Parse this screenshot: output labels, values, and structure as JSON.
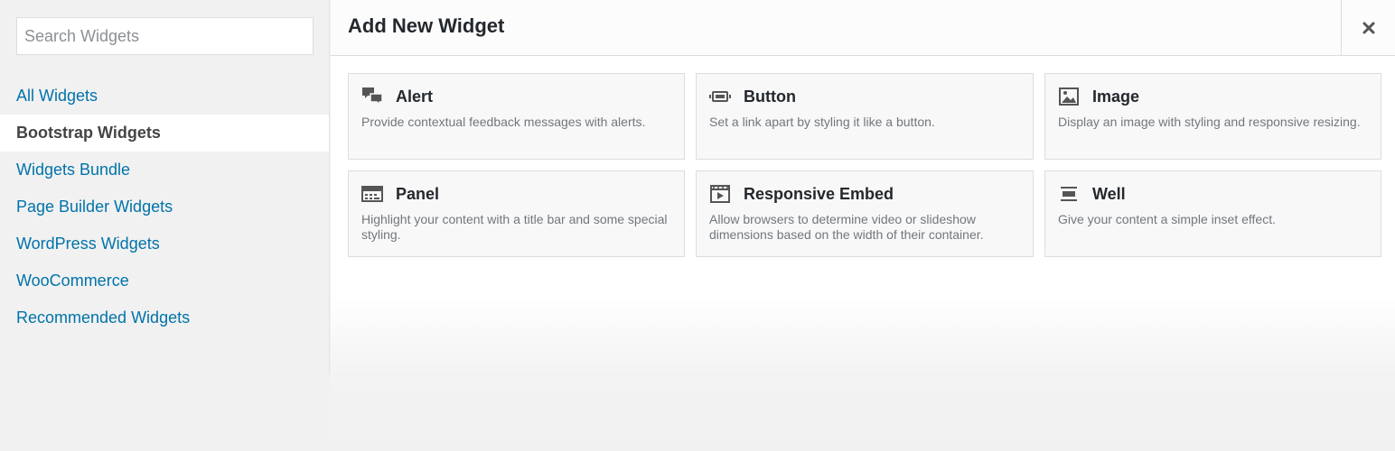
{
  "sidebar": {
    "search": {
      "placeholder": "Search Widgets",
      "value": ""
    },
    "items": [
      {
        "label": "All Widgets",
        "active": false
      },
      {
        "label": "Bootstrap Widgets",
        "active": true
      },
      {
        "label": "Widgets Bundle",
        "active": false
      },
      {
        "label": "Page Builder Widgets",
        "active": false
      },
      {
        "label": "WordPress Widgets",
        "active": false
      },
      {
        "label": "WooCommerce",
        "active": false
      },
      {
        "label": "Recommended Widgets",
        "active": false
      }
    ]
  },
  "header": {
    "title": "Add New Widget",
    "close_icon": "close-icon"
  },
  "widgets": [
    {
      "title": "Alert",
      "description": "Provide contextual feedback messages with alerts.",
      "icon": "speech-bubbles-icon"
    },
    {
      "title": "Button",
      "description": "Set a link apart by styling it like a button.",
      "icon": "button-icon"
    },
    {
      "title": "Image",
      "description": "Display an image with styling and responsive resizing.",
      "icon": "image-icon"
    },
    {
      "title": "Panel",
      "description": "Highlight your content with a title bar and some special styling.",
      "icon": "panel-icon"
    },
    {
      "title": "Responsive Embed",
      "description": "Allow browsers to determine video or slideshow dimensions based on the width of their container.",
      "icon": "video-icon"
    },
    {
      "title": "Well",
      "description": "Give your content a simple inset effect.",
      "icon": "well-icon"
    }
  ],
  "colors": {
    "link": "#0073aa",
    "active_text": "#444444",
    "icon": "#555555"
  }
}
